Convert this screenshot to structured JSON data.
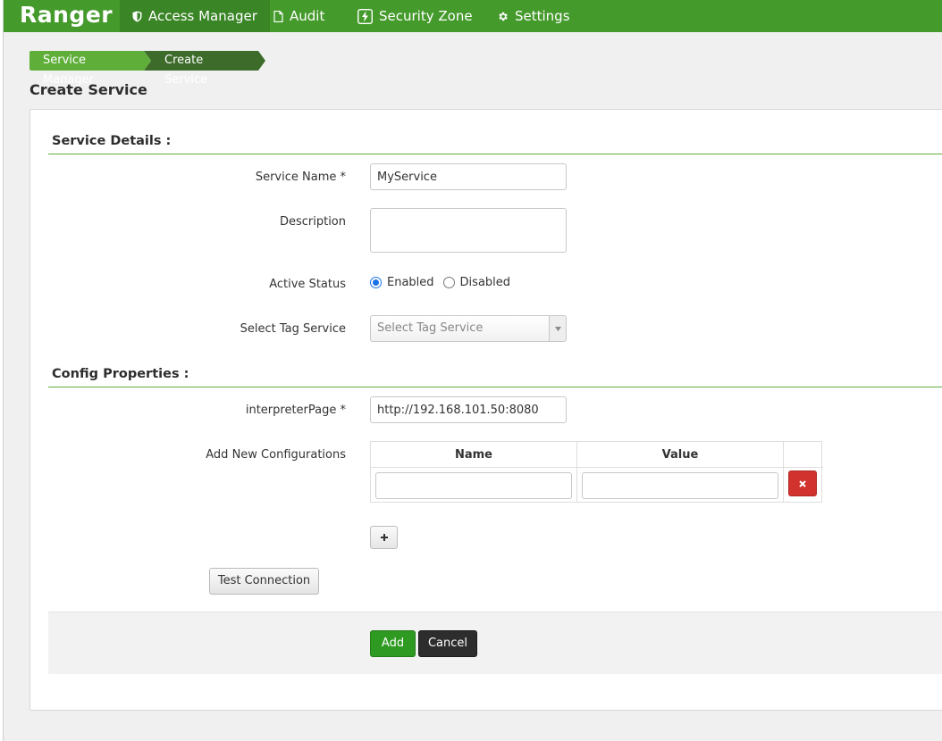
{
  "app": {
    "brand": "Ranger"
  },
  "nav": {
    "items": [
      {
        "label": "Access Manager",
        "icon": "shield-icon",
        "active": true
      },
      {
        "label": "Audit",
        "icon": "file-icon"
      },
      {
        "label": "Security Zone",
        "icon": "lightning-icon"
      },
      {
        "label": "Settings",
        "icon": "gear-icon"
      }
    ]
  },
  "breadcrumb": [
    "Service Manager",
    "Create Service"
  ],
  "page": {
    "title": "Create Service"
  },
  "service_details": {
    "title": "Service Details :",
    "service_name_label": "Service Name *",
    "service_name_value": "MyService",
    "description_label": "Description",
    "description_value": "",
    "active_status_label": "Active Status",
    "status_options": [
      "Enabled",
      "Disabled"
    ],
    "status_selected": "Enabled",
    "tag_service_label": "Select Tag Service",
    "tag_service_placeholder": "Select Tag Service"
  },
  "config": {
    "title": "Config Properties :",
    "interpreter_label": "interpreterPage *",
    "interpreter_value": "http://192.168.101.50:8080",
    "add_new_label": "Add New Configurations",
    "table_headers": [
      "Name",
      "Value"
    ],
    "rows": [
      {
        "name": "",
        "value": ""
      }
    ]
  },
  "buttons": {
    "test_connection": "Test Connection",
    "add": "Add",
    "cancel": "Cancel"
  },
  "colors": {
    "nav_green": "#459a2c",
    "nav_active": "#3a8526",
    "breadcrumb_light": "#5fae3a",
    "breadcrumb_dark": "#3c6b2a",
    "add_button": "#2e9a21",
    "remove_button": "#d2322d"
  }
}
